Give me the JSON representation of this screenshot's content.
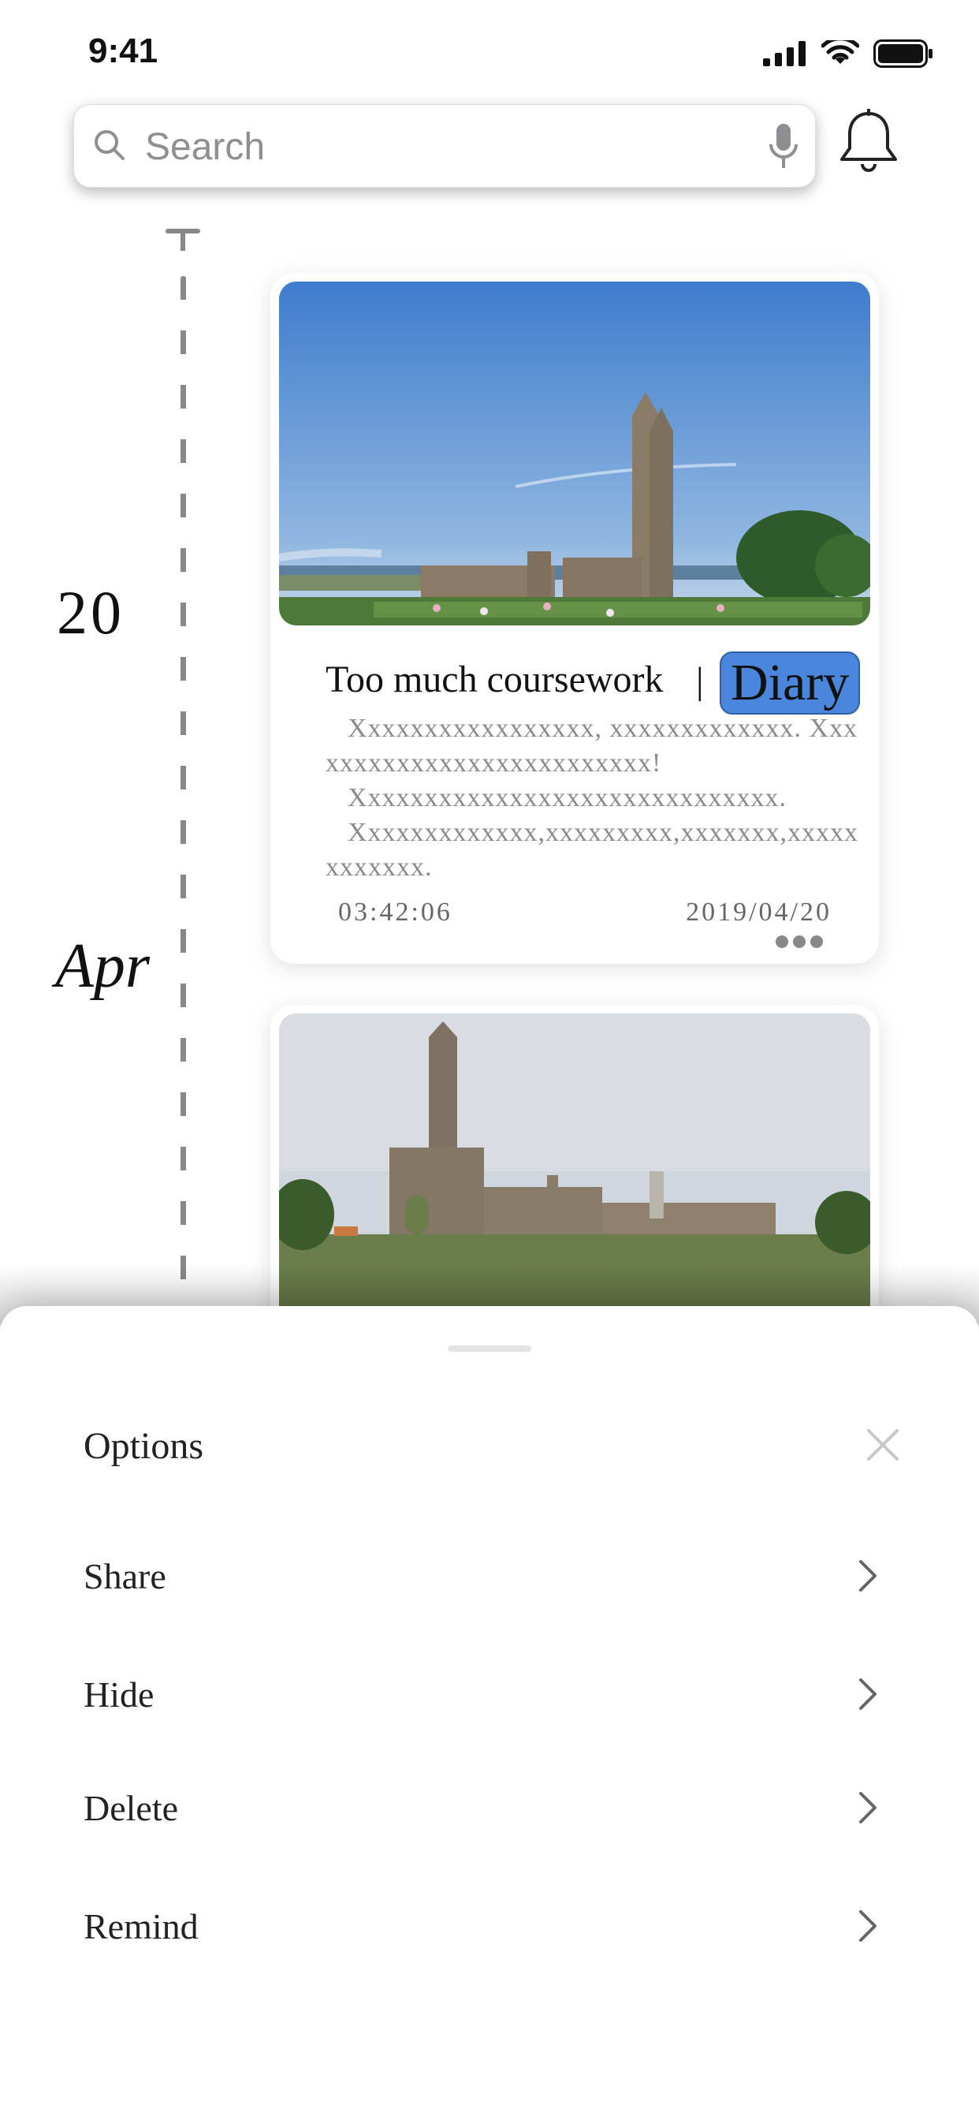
{
  "status_bar": {
    "time": "9:41"
  },
  "search": {
    "placeholder": "Search"
  },
  "timeline": {
    "day": "20",
    "month": "Apr"
  },
  "cards": [
    {
      "title": "Too much coursework",
      "separator": "|",
      "tag": "Diary",
      "body": [
        "Xxxxxxxxxxxxxxxxx, xxxxxxxxxxxxx. Xxxxxxxxxxxxxxxxxxxxxxxxxx!",
        "Xxxxxxxxxxxxxxxxxxxxxxxxxxxxxx.",
        "Xxxxxxxxxxxxx,xxxxxxxxx,xxxxxxx,xxxxxxxxxxxx."
      ],
      "time": "03:42:06",
      "date": "2019/04/20"
    }
  ],
  "sheet": {
    "title": "Options",
    "options": [
      "Share",
      "Hide",
      "Delete",
      "Remind"
    ]
  },
  "colors": {
    "tag_bg": "#4a86dc",
    "timeline": "#888888",
    "muted_text": "#8a8a8a"
  }
}
